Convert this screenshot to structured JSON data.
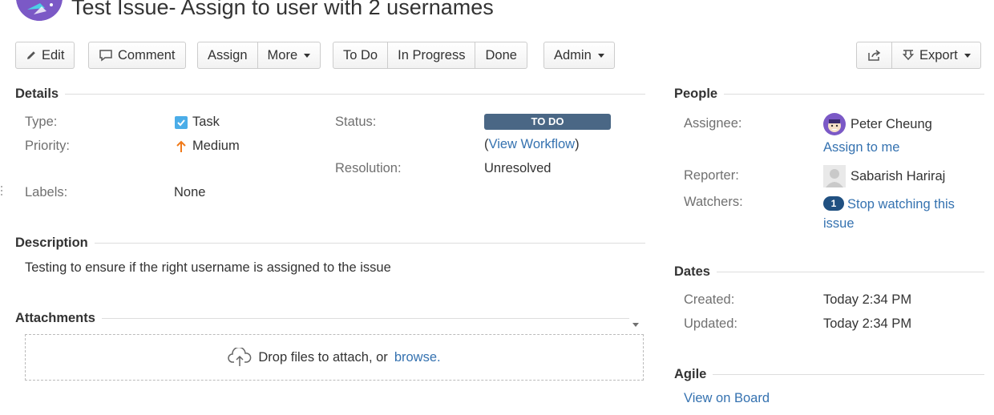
{
  "issue": {
    "title": "Test Issue- Assign to user with 2 usernames"
  },
  "toolbar": {
    "edit": "Edit",
    "comment": "Comment",
    "assign": "Assign",
    "more": "More",
    "todo": "To Do",
    "in_progress": "In Progress",
    "done": "Done",
    "admin": "Admin",
    "export": "Export"
  },
  "details": {
    "heading": "Details",
    "type_label": "Type:",
    "type_value": "Task",
    "priority_label": "Priority:",
    "priority_value": "Medium",
    "labels_label": "Labels:",
    "labels_value": "None",
    "status_label": "Status:",
    "status_value": "TO DO",
    "workflow_open": "(",
    "workflow_link": "View Workflow",
    "workflow_close": ")",
    "resolution_label": "Resolution:",
    "resolution_value": "Unresolved"
  },
  "description": {
    "heading": "Description",
    "text": "Testing to ensure if the right username is assigned to the issue"
  },
  "attachments": {
    "heading": "Attachments",
    "drop_text": "Drop files to attach, or",
    "browse_link": "browse."
  },
  "people": {
    "heading": "People",
    "assignee_label": "Assignee:",
    "assignee_name": "Peter Cheung",
    "assign_to_me": "Assign to me",
    "reporter_label": "Reporter:",
    "reporter_name": "Sabarish Hariraj",
    "watchers_label": "Watchers:",
    "watchers_count": "1",
    "watch_link_line1": "Stop watching this",
    "watch_link_line2": "issue"
  },
  "dates": {
    "heading": "Dates",
    "created_label": "Created:",
    "created_value": "Today 2:34 PM",
    "updated_label": "Updated:",
    "updated_value": "Today 2:34 PM"
  },
  "agile": {
    "heading": "Agile",
    "view_on_board": "View on Board"
  },
  "icons": {
    "project_avatar": "rocket-avatar",
    "edit": "pencil-icon",
    "comment": "speech-bubble-icon",
    "share": "share-icon",
    "export": "download-icon",
    "task_type": "checkbox-task-icon",
    "priority": "arrow-up-icon",
    "upload": "cloud-upload-icon"
  },
  "colors": {
    "link": "#3572b0",
    "status_todo": "#4a6785",
    "priority_medium": "#f07a1a",
    "task_blue": "#4bade8",
    "avatar_purple": "#7b59c6"
  }
}
